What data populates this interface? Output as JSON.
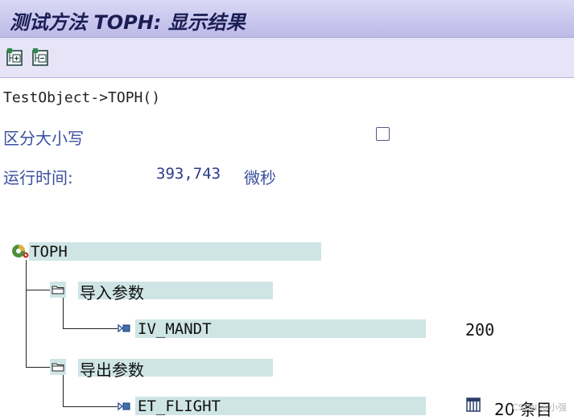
{
  "window": {
    "title": "测试方法 TOPH: 显示结果"
  },
  "toolbar": {
    "buttons": [
      {
        "name": "expand-all",
        "icon": "expand-tree-icon"
      },
      {
        "name": "collapse-all",
        "icon": "collapse-tree-icon"
      }
    ]
  },
  "method": {
    "signature": "TestObject->TOPH()"
  },
  "options": {
    "case_sensitive_label": "区分大小写",
    "case_sensitive_checked": false
  },
  "runtime": {
    "label": "运行时间:",
    "value": "393,743",
    "unit": "微秒"
  },
  "tree": {
    "root": {
      "label": "TOPH",
      "icon": "function-module-icon"
    },
    "import": {
      "label": "导入参数",
      "params": [
        {
          "name": "IV_MANDT",
          "value": "200"
        }
      ]
    },
    "export": {
      "label": "导出参数",
      "params": [
        {
          "name": "ET_FLIGHT",
          "value": "20 条目",
          "icon": "table-icon"
        }
      ]
    }
  },
  "watermark": "CSDN @小强"
}
